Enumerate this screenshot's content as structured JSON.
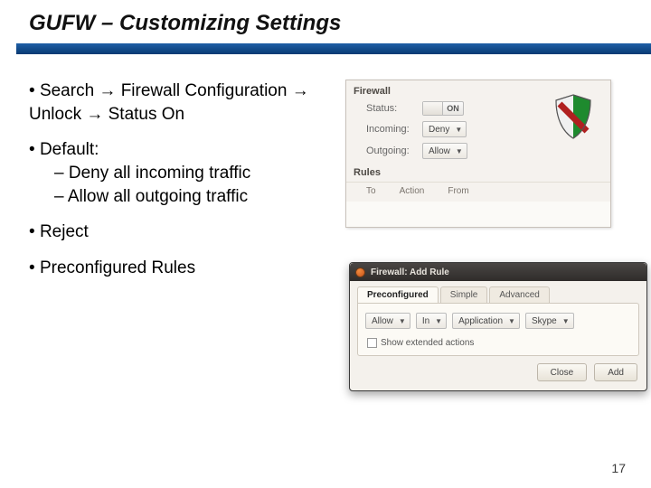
{
  "slide": {
    "title": "GUFW – Customizing Settings",
    "page_number": "17"
  },
  "bullets": {
    "b1": "Search → Firewall Configuration → Unlock → Status On",
    "b2": "Default:",
    "b2a": "Deny all incoming traffic",
    "b2b": "Allow all outgoing traffic",
    "b3": "Reject",
    "b4": "Preconfigured Rules"
  },
  "fw_panel": {
    "section_firewall": "Firewall",
    "status_label": "Status:",
    "status_value": "ON",
    "incoming_label": "Incoming:",
    "incoming_value": "Deny",
    "outgoing_label": "Outgoing:",
    "outgoing_value": "Allow",
    "section_rules": "Rules",
    "col_to": "To",
    "col_action": "Action",
    "col_from": "From"
  },
  "add_rule": {
    "window_title": "Firewall: Add Rule",
    "tabs": {
      "t1": "Preconfigured",
      "t2": "Simple",
      "t3": "Advanced"
    },
    "dd_policy": "Allow",
    "dd_direction": "In",
    "dd_kind": "Application",
    "dd_app": "Skype",
    "checkbox_label": "Show extended actions",
    "btn_close": "Close",
    "btn_add": "Add"
  }
}
